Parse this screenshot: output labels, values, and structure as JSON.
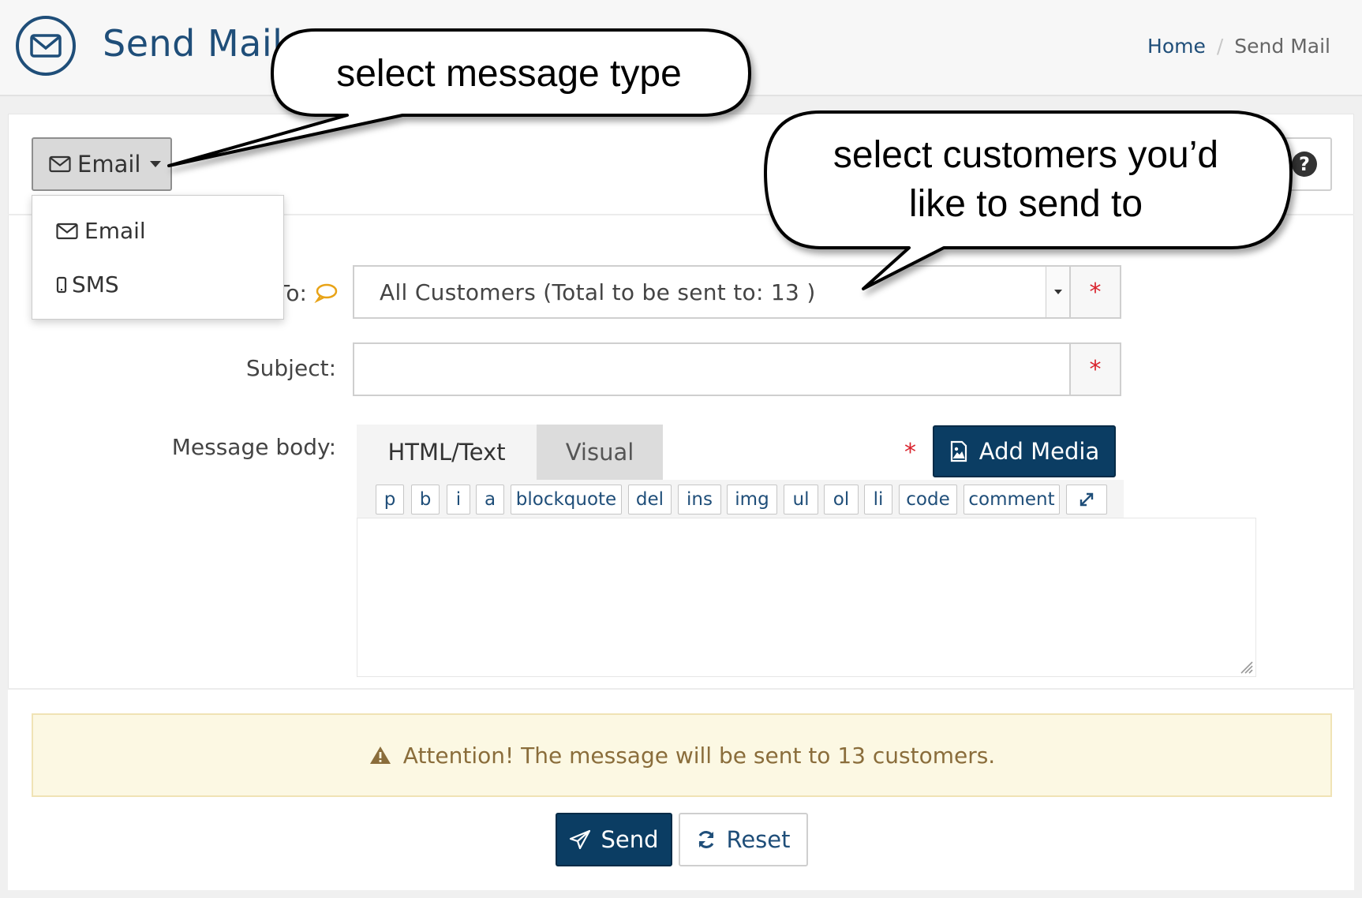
{
  "header": {
    "title": "Send Mail",
    "breadcrumb": {
      "home": "Home",
      "separator": "/",
      "current": "Send Mail"
    }
  },
  "message_type": {
    "selected_label": "Email",
    "options": [
      {
        "label": "Email",
        "icon": "envelope-icon"
      },
      {
        "label": "SMS",
        "icon": "mobile-phone-icon"
      }
    ]
  },
  "form": {
    "to_label": "To:",
    "to_value": "All Customers (Total to be sent to: 13 )",
    "subject_label": "Subject:",
    "subject_value": "",
    "body_label": "Message body:",
    "required_marker": "*"
  },
  "editor": {
    "tabs": [
      "HTML/Text",
      "Visual"
    ],
    "active_tab": "HTML/Text",
    "add_media_label": "Add Media",
    "quicktags": [
      "p",
      "b",
      "i",
      "a",
      "blockquote",
      "del",
      "ins",
      "img",
      "ul",
      "ol",
      "li",
      "code",
      "comment"
    ]
  },
  "alert": {
    "text": "Attention! The message will be sent to 13 customers."
  },
  "actions": {
    "send_label": "Send",
    "reset_label": "Reset"
  },
  "annotations": {
    "callout_type": "select message type",
    "callout_customers_line1": "select customers you’d",
    "callout_customers_line2": "like to send to"
  },
  "colors": {
    "brand": "#1f4e79",
    "primary_button": "#0b3d63",
    "required": "#d9232d",
    "alert_bg": "#fcf8e3",
    "alert_text": "#8a6d3b"
  }
}
